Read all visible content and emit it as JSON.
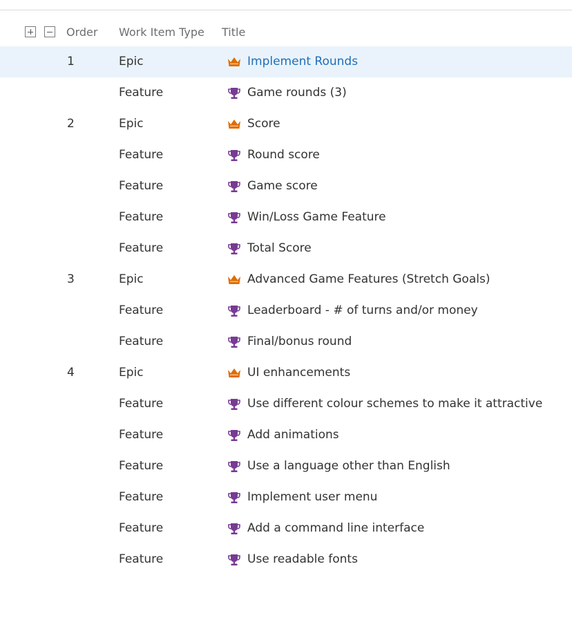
{
  "header": {
    "expand_all_icon": "plus-box-icon",
    "collapse_all_icon": "minus-box-icon",
    "columns": {
      "order": "Order",
      "work_item_type": "Work Item Type",
      "title": "Title"
    }
  },
  "icons": {
    "epic": {
      "name": "crown-icon",
      "color": "#e06c00"
    },
    "feature": {
      "name": "trophy-icon",
      "color": "#773b93"
    }
  },
  "selection_color": "#eaf3fb",
  "link_color": "#1f6fb8",
  "rows": [
    {
      "order": "1",
      "type": "Epic",
      "title": "Implement Rounds",
      "selected": true
    },
    {
      "order": "",
      "type": "Feature",
      "title": "Game rounds (3)"
    },
    {
      "order": "2",
      "type": "Epic",
      "title": "Score"
    },
    {
      "order": "",
      "type": "Feature",
      "title": "Round score"
    },
    {
      "order": "",
      "type": "Feature",
      "title": "Game score"
    },
    {
      "order": "",
      "type": "Feature",
      "title": "Win/Loss Game Feature"
    },
    {
      "order": "",
      "type": "Feature",
      "title": "Total Score"
    },
    {
      "order": "3",
      "type": "Epic",
      "title": "Advanced Game Features (Stretch Goals)"
    },
    {
      "order": "",
      "type": "Feature",
      "title": "Leaderboard - # of turns and/or money"
    },
    {
      "order": "",
      "type": "Feature",
      "title": "Final/bonus round"
    },
    {
      "order": "4",
      "type": "Epic",
      "title": "UI enhancements"
    },
    {
      "order": "",
      "type": "Feature",
      "title": "Use different colour schemes to make it attractive"
    },
    {
      "order": "",
      "type": "Feature",
      "title": "Add animations"
    },
    {
      "order": "",
      "type": "Feature",
      "title": "Use a language other than English"
    },
    {
      "order": "",
      "type": "Feature",
      "title": "Implement user menu"
    },
    {
      "order": "",
      "type": "Feature",
      "title": "Add a command line interface"
    },
    {
      "order": "",
      "type": "Feature",
      "title": "Use readable fonts"
    }
  ]
}
